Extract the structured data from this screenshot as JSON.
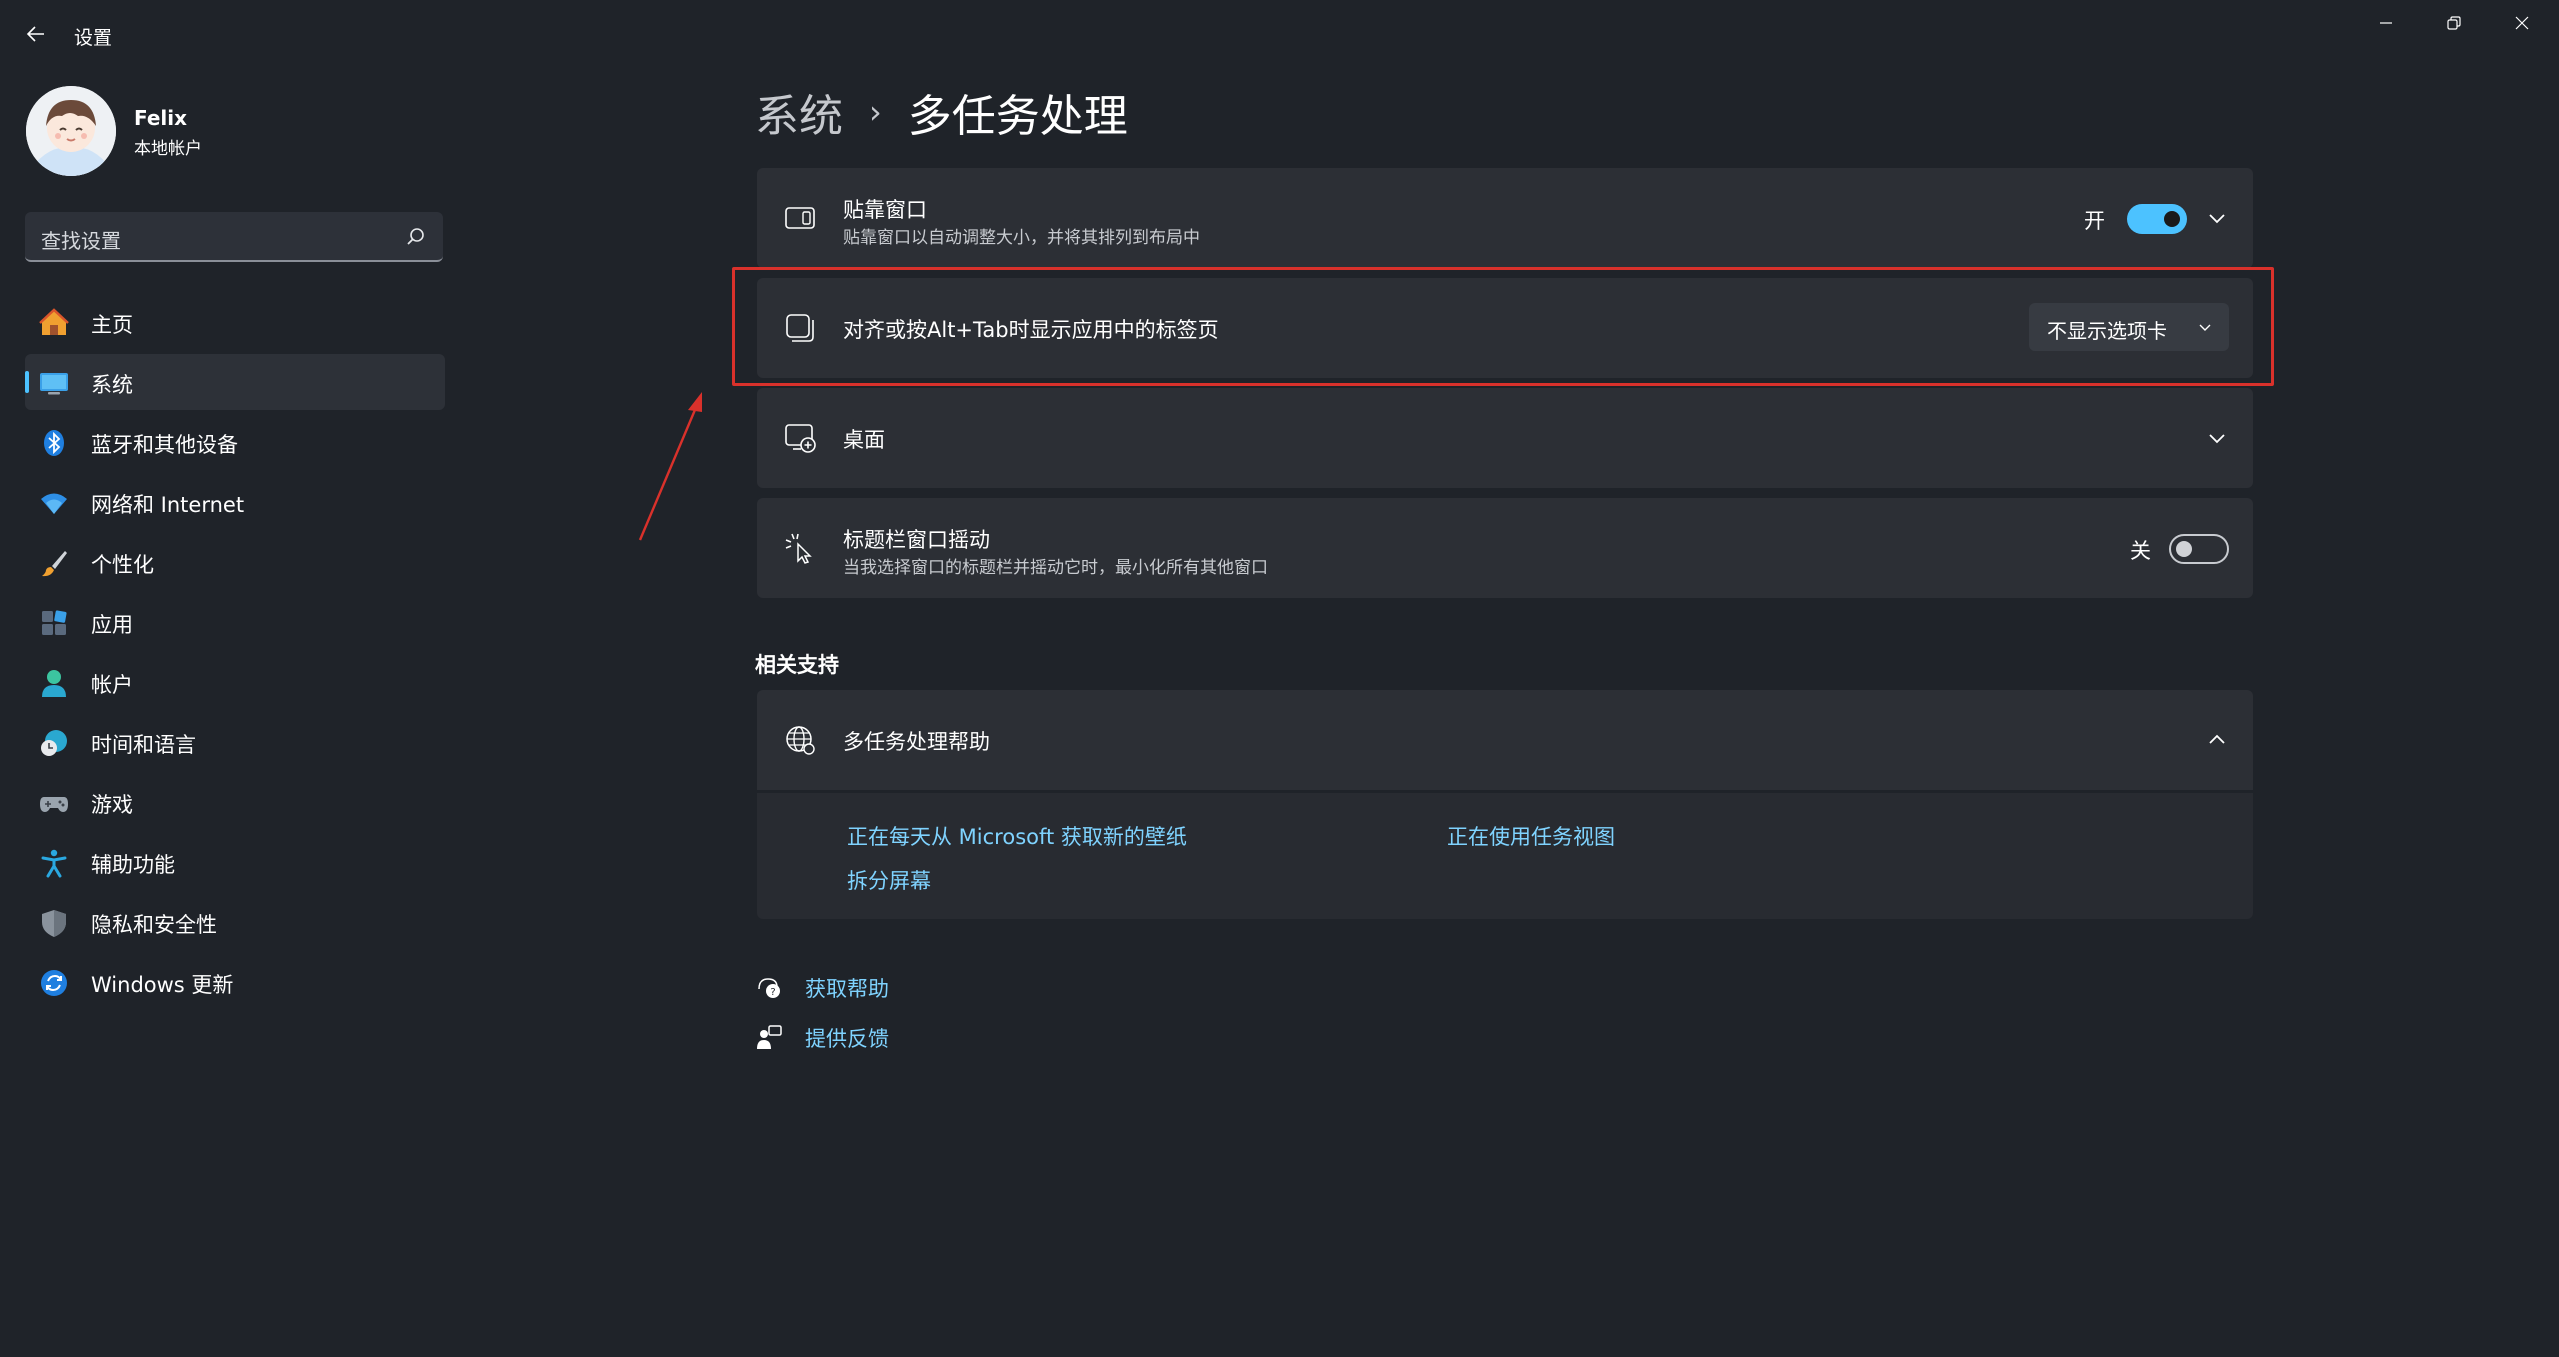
{
  "window": {
    "title": "设置"
  },
  "profile": {
    "name": "Felix",
    "account_type": "本地帐户"
  },
  "search": {
    "placeholder": "查找设置"
  },
  "sidebar": {
    "items": [
      {
        "label": "主页",
        "icon": "home-icon",
        "active": false
      },
      {
        "label": "系统",
        "icon": "monitor-icon",
        "active": true
      },
      {
        "label": "蓝牙和其他设备",
        "icon": "bluetooth-icon",
        "active": false
      },
      {
        "label": "网络和 Internet",
        "icon": "wifi-icon",
        "active": false
      },
      {
        "label": "个性化",
        "icon": "brush-icon",
        "active": false
      },
      {
        "label": "应用",
        "icon": "apps-icon",
        "active": false
      },
      {
        "label": "帐户",
        "icon": "person-icon",
        "active": false
      },
      {
        "label": "时间和语言",
        "icon": "globe-clock-icon",
        "active": false
      },
      {
        "label": "游戏",
        "icon": "gamepad-icon",
        "active": false
      },
      {
        "label": "辅助功能",
        "icon": "accessibility-icon",
        "active": false
      },
      {
        "label": "隐私和安全性",
        "icon": "shield-icon",
        "active": false
      },
      {
        "label": "Windows 更新",
        "icon": "refresh-icon",
        "active": false
      }
    ]
  },
  "breadcrumb": {
    "parent": "系统",
    "separator": "›",
    "current": "多任务处理"
  },
  "settings": {
    "snap": {
      "title": "贴靠窗口",
      "description": "贴靠窗口以自动调整大小，并将其排列到布局中",
      "toggle_label": "开",
      "enabled": true
    },
    "alt_tab": {
      "title": "对齐或按Alt+Tab时显示应用中的标签页",
      "dropdown_value": "不显示选项卡"
    },
    "desktops": {
      "title": "桌面"
    },
    "shake": {
      "title": "标题栏窗口摇动",
      "description": "当我选择窗口的标题栏并摇动它时，最小化所有其他窗口",
      "toggle_label": "关",
      "enabled": false
    }
  },
  "related": {
    "section_title": "相关支持",
    "help_title": "多任务处理帮助",
    "links": [
      "正在每天从 Microsoft 获取新的壁纸",
      "正在使用任务视图",
      "拆分屏幕"
    ]
  },
  "footer": {
    "get_help": "获取帮助",
    "feedback": "提供反馈"
  },
  "colors": {
    "background": "#1f2329",
    "card": "#2c2f35",
    "accent": "#4cc2ff",
    "link": "#7fd3ff",
    "highlight": "#d9312b"
  }
}
